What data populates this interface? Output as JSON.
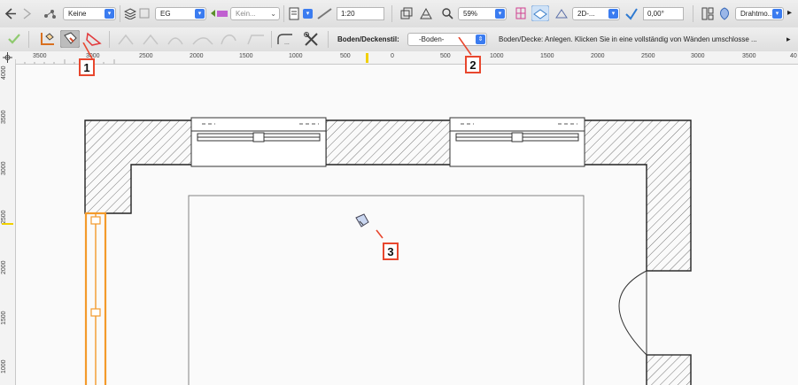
{
  "toolbar1": {
    "class_select": "Keine",
    "layer_select": "EG",
    "view_select": "Kein...",
    "scale": "1:20",
    "zoom": "59%",
    "view_mode": "2D-...",
    "angle": "0,00°",
    "render_mode": "Drahtmo..."
  },
  "toolbar2": {
    "style_label": "Boden/Deckenstil:",
    "style_value": "-Boden-",
    "hint": "Boden/Decke: Anlegen. Klicken Sie in eine vollständig von Wänden umschlosse ..."
  },
  "ruler_top": [
    "3500",
    "3000",
    "2500",
    "2000",
    "1500",
    "1000",
    "500",
    "0",
    "500",
    "1000",
    "1500",
    "2000",
    "2500",
    "3000",
    "3500",
    "40"
  ],
  "ruler_left": [
    "4000",
    "3500",
    "3000",
    "2500",
    "2000",
    "1500",
    "1000"
  ],
  "callouts": [
    "1",
    "2",
    "3"
  ],
  "colors": {
    "accent": "#3b7cf0",
    "selection": "#f39a2b",
    "callout": "#e8472e"
  }
}
